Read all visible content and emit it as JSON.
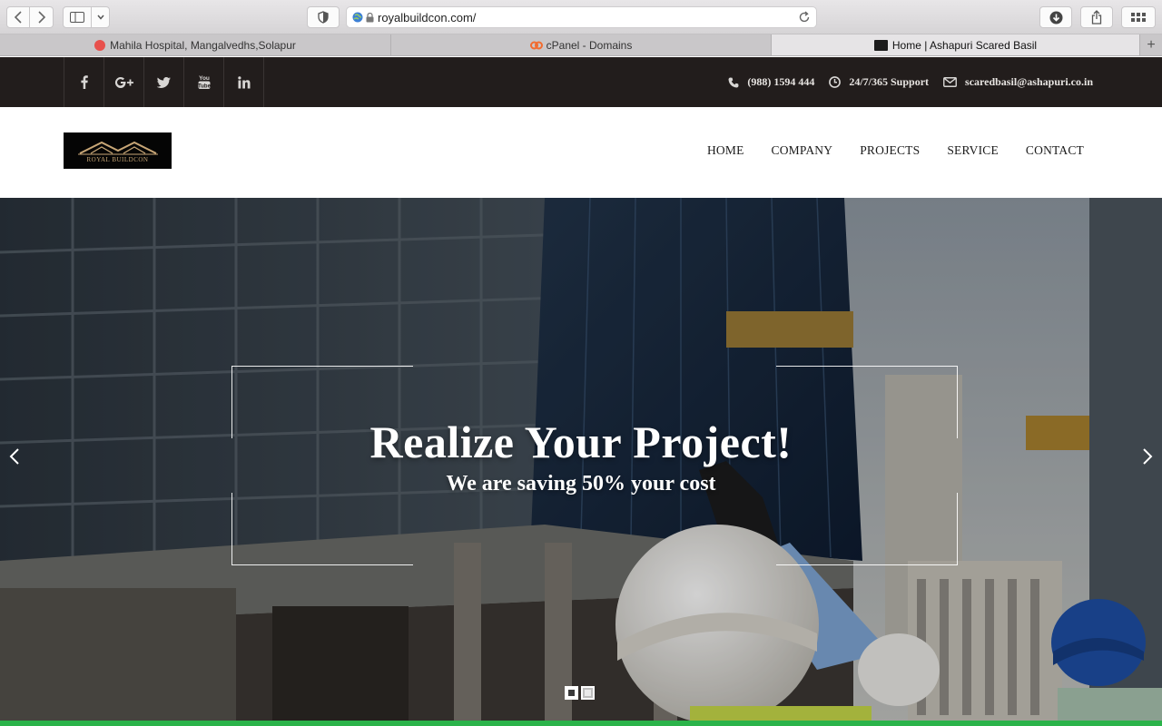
{
  "browser": {
    "url": "royalbuildcon.com/",
    "tabs": [
      {
        "label": "Mahila Hospital, Mangalvedhs,Solapur",
        "favicon_color": "#e8514d"
      },
      {
        "label": "cPanel - Domains",
        "favicon_color": "#f26c2f"
      },
      {
        "label": "Home | Ashapuri Scared Basil",
        "favicon_color": "#1c1c1c"
      }
    ],
    "new_tab": "+"
  },
  "topbar": {
    "social": [
      {
        "glyph": "f",
        "icon": "facebook-icon"
      },
      {
        "glyph": "G+",
        "icon": "google-plus-icon"
      },
      {
        "glyph": "twitter",
        "icon": "twitter-icon"
      },
      {
        "glyph": "You",
        "icon": "youtube-icon"
      },
      {
        "glyph": "in",
        "icon": "linkedin-icon"
      }
    ],
    "phone": "(988) 1594 444",
    "support": "24/7/365 Support",
    "email": "scaredbasil@ashapuri.co.in"
  },
  "header": {
    "logo_text": "Royal Buildcon",
    "nav": [
      "HOME",
      "COMPANY",
      "PROJECTS",
      "SERVICE",
      "CONTACT"
    ]
  },
  "hero": {
    "title": "Realize Your Project!",
    "subtitle": "We are saving 50% your cost",
    "slides": 2,
    "active_slide": 1
  },
  "colors": {
    "topbar_bg": "#221d1c",
    "accent_green": "#2bb34a",
    "logo_gold": "#c9a777"
  }
}
